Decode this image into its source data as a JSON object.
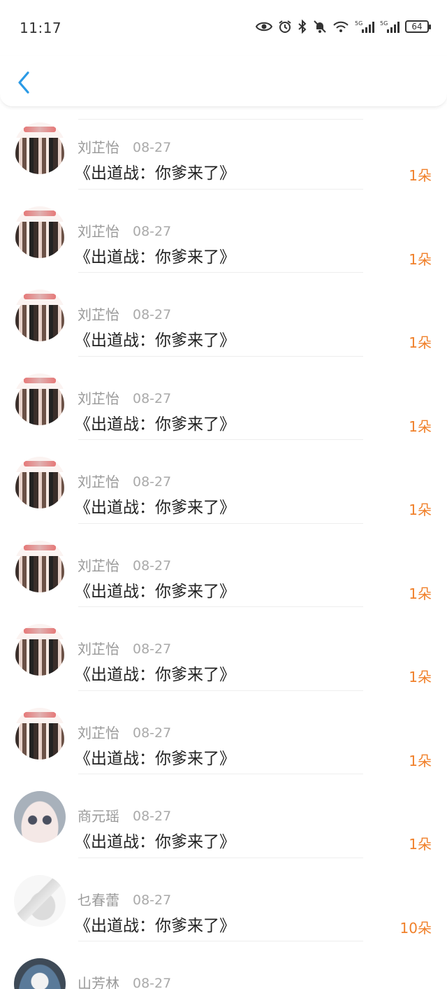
{
  "status_bar": {
    "time": "11:17",
    "battery": "64",
    "icons": [
      "eye-icon",
      "alarm-icon",
      "bluetooth-icon",
      "mute-bell-icon",
      "wifi-icon",
      "signal-5g-icon",
      "signal-5g-icon"
    ],
    "network_label": "5G"
  },
  "header": {
    "back_icon": "chevron-left-icon",
    "accent_color": "#2a9ae6"
  },
  "colors": {
    "amount": "#f0802a",
    "meta": "#999999",
    "title": "#222222"
  },
  "gifts": [
    {
      "name": "刘芷怡",
      "date": "08-27",
      "title": "《出道战：你爹来了》",
      "amount": "1朵",
      "avatar": "collage"
    },
    {
      "name": "刘芷怡",
      "date": "08-27",
      "title": "《出道战：你爹来了》",
      "amount": "1朵",
      "avatar": "collage"
    },
    {
      "name": "刘芷怡",
      "date": "08-27",
      "title": "《出道战：你爹来了》",
      "amount": "1朵",
      "avatar": "collage"
    },
    {
      "name": "刘芷怡",
      "date": "08-27",
      "title": "《出道战：你爹来了》",
      "amount": "1朵",
      "avatar": "collage"
    },
    {
      "name": "刘芷怡",
      "date": "08-27",
      "title": "《出道战：你爹来了》",
      "amount": "1朵",
      "avatar": "collage"
    },
    {
      "name": "刘芷怡",
      "date": "08-27",
      "title": "《出道战：你爹来了》",
      "amount": "1朵",
      "avatar": "collage"
    },
    {
      "name": "刘芷怡",
      "date": "08-27",
      "title": "《出道战：你爹来了》",
      "amount": "1朵",
      "avatar": "collage"
    },
    {
      "name": "刘芷怡",
      "date": "08-27",
      "title": "《出道战：你爹来了》",
      "amount": "1朵",
      "avatar": "collage"
    },
    {
      "name": "商元瑶",
      "date": "08-27",
      "title": "《出道战：你爹来了》",
      "amount": "1朵",
      "avatar": "anime"
    },
    {
      "name": "乜春蕾",
      "date": "08-27",
      "title": "《出道战：你爹来了》",
      "amount": "10朵",
      "avatar": "pale"
    },
    {
      "name": "山芳林",
      "date": "08-27",
      "title": "",
      "amount": "",
      "avatar": "blue"
    }
  ]
}
